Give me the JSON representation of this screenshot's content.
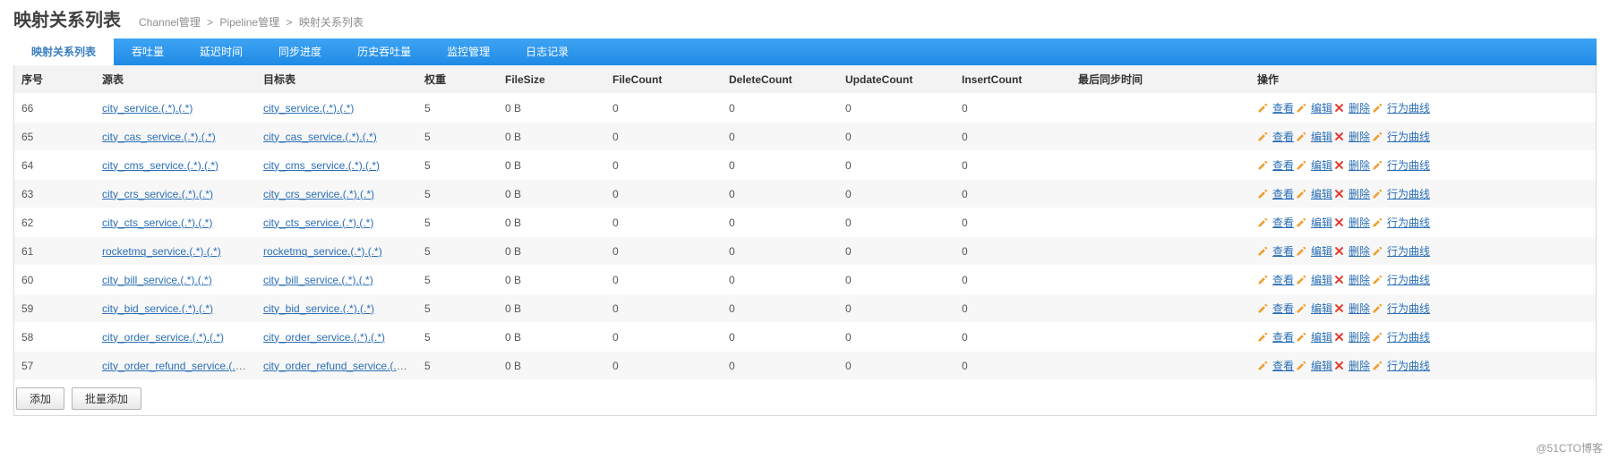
{
  "header": {
    "title": "映射关系列表",
    "breadcrumbs": [
      "Channel管理",
      "Pipeline管理",
      "映射关系列表"
    ]
  },
  "tabs": [
    {
      "label": "映射关系列表",
      "active": true
    },
    {
      "label": "吞吐量"
    },
    {
      "label": "延迟时间"
    },
    {
      "label": "同步进度"
    },
    {
      "label": "历史吞吐量"
    },
    {
      "label": "监控管理"
    },
    {
      "label": "日志记录"
    }
  ],
  "columns": {
    "seq": "序号",
    "src": "源表",
    "dst": "目标表",
    "weight": "权重",
    "filesize": "FileSize",
    "filecount": "FileCount",
    "deletecount": "DeleteCount",
    "updatecount": "UpdateCount",
    "insertcount": "InsertCount",
    "lastsync": "最后同步时间",
    "ops": "操作"
  },
  "actions": {
    "view": "查看",
    "edit": "编辑",
    "delete": "删除",
    "curve": "行为曲线"
  },
  "rows": [
    {
      "seq": "66",
      "src": "city_service.(.*).(.*)",
      "dst": "city_service.(.*).(.*)",
      "weight": "5",
      "filesize": "0 B",
      "filecount": "0",
      "deletecount": "0",
      "updatecount": "0",
      "insertcount": "0",
      "lastsync": ""
    },
    {
      "seq": "65",
      "src": "city_cas_service.(.*).(.*)",
      "dst": "city_cas_service.(.*).(.*)",
      "weight": "5",
      "filesize": "0 B",
      "filecount": "0",
      "deletecount": "0",
      "updatecount": "0",
      "insertcount": "0",
      "lastsync": ""
    },
    {
      "seq": "64",
      "src": "city_cms_service.(.*).(.*)",
      "dst": "city_cms_service.(.*).(.*)",
      "weight": "5",
      "filesize": "0 B",
      "filecount": "0",
      "deletecount": "0",
      "updatecount": "0",
      "insertcount": "0",
      "lastsync": ""
    },
    {
      "seq": "63",
      "src": "city_crs_service.(.*).(.*)",
      "dst": "city_crs_service.(.*).(.*)",
      "weight": "5",
      "filesize": "0 B",
      "filecount": "0",
      "deletecount": "0",
      "updatecount": "0",
      "insertcount": "0",
      "lastsync": ""
    },
    {
      "seq": "62",
      "src": "city_cts_service.(.*).(.*)",
      "dst": "city_cts_service.(.*).(.*)",
      "weight": "5",
      "filesize": "0 B",
      "filecount": "0",
      "deletecount": "0",
      "updatecount": "0",
      "insertcount": "0",
      "lastsync": ""
    },
    {
      "seq": "61",
      "src": "rocketmq_service.(.*).(.*)",
      "dst": "rocketmq_service.(.*).(.*)",
      "weight": "5",
      "filesize": "0 B",
      "filecount": "0",
      "deletecount": "0",
      "updatecount": "0",
      "insertcount": "0",
      "lastsync": ""
    },
    {
      "seq": "60",
      "src": "city_bill_service.(.*).(.*)",
      "dst": "city_bill_service.(.*).(.*)",
      "weight": "5",
      "filesize": "0 B",
      "filecount": "0",
      "deletecount": "0",
      "updatecount": "0",
      "insertcount": "0",
      "lastsync": ""
    },
    {
      "seq": "59",
      "src": "city_bid_service.(.*).(.*)",
      "dst": "city_bid_service.(.*).(.*)",
      "weight": "5",
      "filesize": "0 B",
      "filecount": "0",
      "deletecount": "0",
      "updatecount": "0",
      "insertcount": "0",
      "lastsync": ""
    },
    {
      "seq": "58",
      "src": "city_order_service.(.*).(.*)",
      "dst": "city_order_service.(.*).(.*)",
      "weight": "5",
      "filesize": "0 B",
      "filecount": "0",
      "deletecount": "0",
      "updatecount": "0",
      "insertcount": "0",
      "lastsync": ""
    },
    {
      "seq": "57",
      "src": "city_order_refund_service.(.*).(.*)",
      "dst": "city_order_refund_service.(.*).(.*)",
      "weight": "5",
      "filesize": "0 B",
      "filecount": "0",
      "deletecount": "0",
      "updatecount": "0",
      "insertcount": "0",
      "lastsync": ""
    }
  ],
  "footer": {
    "add": "添加",
    "batch_add": "批量添加"
  },
  "watermark": "@51CTO博客"
}
